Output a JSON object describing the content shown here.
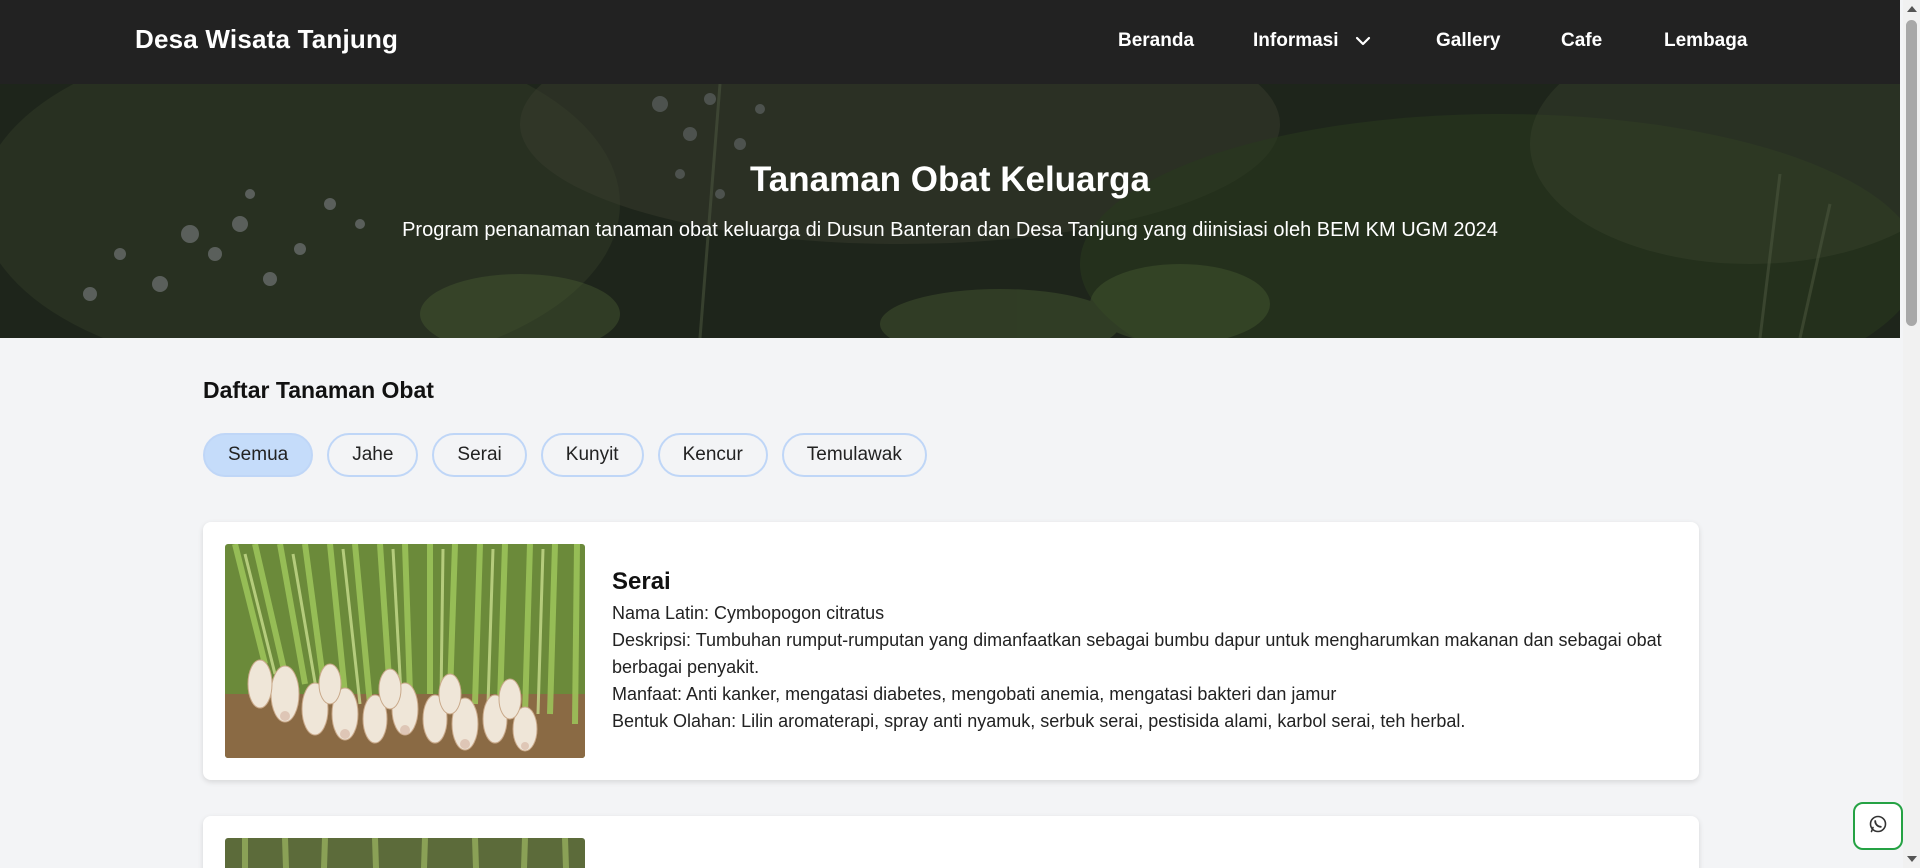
{
  "navbar": {
    "brand": "Desa Wisata Tanjung",
    "links": [
      "Beranda",
      "Informasi",
      "Gallery",
      "Cafe",
      "Lembaga"
    ]
  },
  "hero": {
    "title": "Tanaman Obat Keluarga",
    "subtitle": "Program penanaman tanaman obat keluarga di Dusun Banteran dan Desa Tanjung yang diinisiasi oleh BEM KM UGM 2024"
  },
  "section": {
    "title": "Daftar Tanaman Obat",
    "filters": [
      "Semua",
      "Jahe",
      "Serai",
      "Kunyit",
      "Kencur",
      "Temulawak"
    ],
    "active_filter": "Semua"
  },
  "cards": [
    {
      "name": "Serai",
      "latin": "Nama Latin: Cymbopogon citratus",
      "description": "Deskripsi: Tumbuhan rumput-rumputan yang dimanfaatkan sebagai bumbu dapur untuk mengharumkan makanan dan sebagai obat berbagai penyakit.",
      "benefits": "Manfaat: Anti kanker, mengatasi diabetes, mengobati anemia, mengatasi bakteri dan jamur",
      "products": "Bentuk Olahan: Lilin aromaterapi, spray anti nyamuk, serbuk serai, pestisida alami, karbol serai, teh herbal."
    }
  ],
  "colors": {
    "navbar_bg": "#222222",
    "page_bg": "#f3f4f6",
    "chip_border": "#bfd6f7",
    "chip_active_bg": "#c5dcfa",
    "whatsapp_green": "#25a244"
  },
  "icons": {
    "informasi_dropdown": "chevron-down-icon",
    "floating_button": "whatsapp-icon"
  }
}
